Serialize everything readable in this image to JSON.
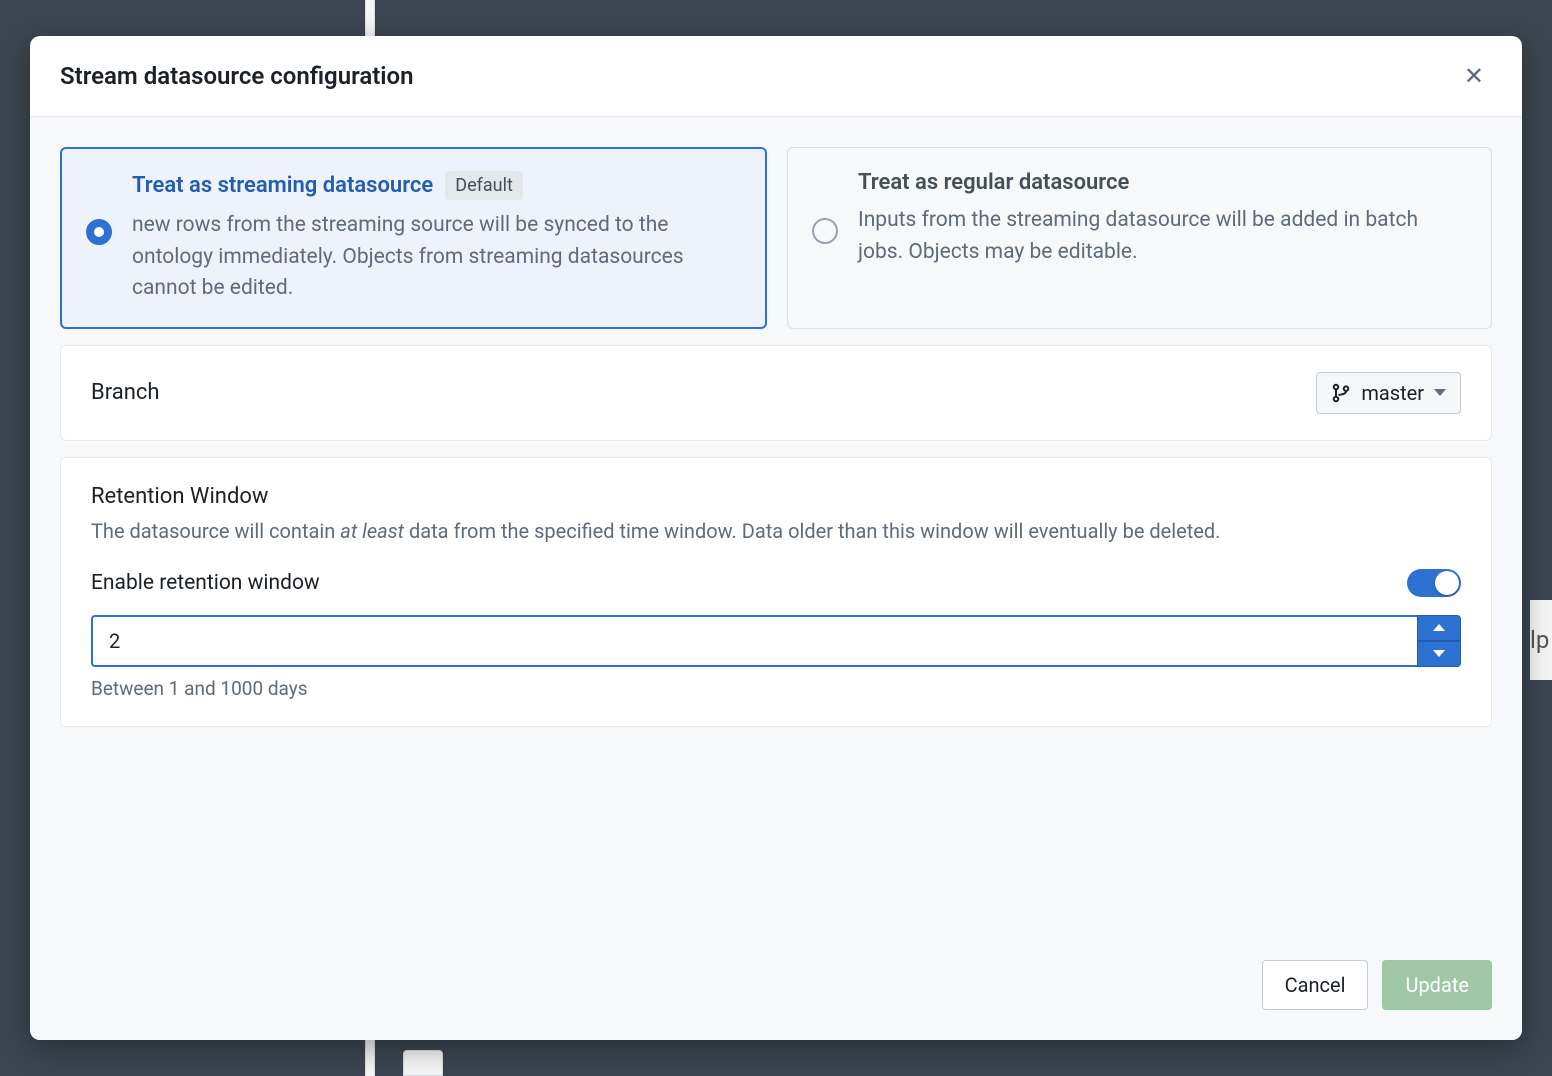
{
  "dialog": {
    "title": "Stream datasource configuration",
    "options": {
      "streaming": {
        "title": "Treat as streaming datasource",
        "default_tag": "Default",
        "desc": "new rows from the streaming source will be synced to the ontology immediately. Objects from streaming datasources cannot be edited.",
        "selected": true
      },
      "regular": {
        "title": "Treat as regular datasource",
        "desc": "Inputs from the streaming datasource will be added in batch jobs. Objects may be editable.",
        "selected": false
      }
    },
    "branch": {
      "label": "Branch",
      "value": "master"
    },
    "retention": {
      "title": "Retention Window",
      "desc_pre": "The datasource will contain ",
      "desc_em": "at least",
      "desc_post": " data from the specified time window. Data older than this window will eventually be deleted.",
      "enable_label": "Enable retention window",
      "enabled": true,
      "value": "2",
      "hint": "Between 1 and 1000 days"
    },
    "footer": {
      "cancel": "Cancel",
      "update": "Update"
    }
  }
}
